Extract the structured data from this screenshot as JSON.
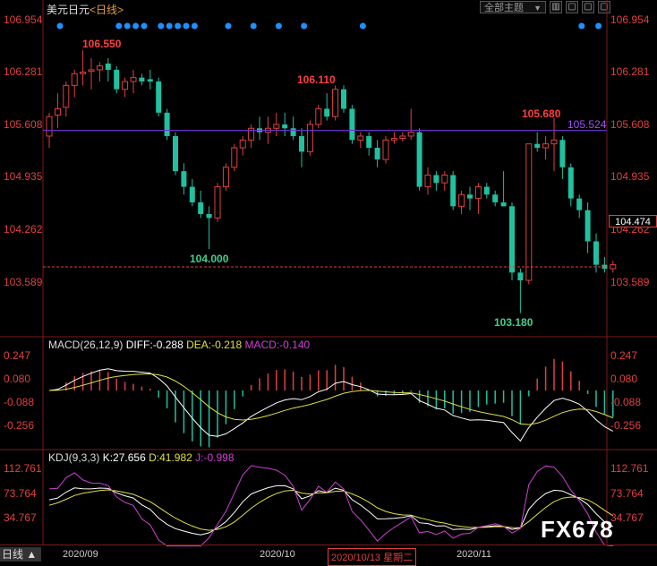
{
  "header": {
    "symbol": "美元日元",
    "period": "<日线>",
    "theme_button": "全部主题",
    "theme_arrow": "▼",
    "window_buttons": [
      "▥",
      "▢",
      "▢",
      "▢"
    ]
  },
  "price_axis": [
    "106.954",
    "106.281",
    "105.608",
    "104.935",
    "104.262",
    "103.589"
  ],
  "current_price": "104.474",
  "annotations": {
    "high1": "106.550",
    "high2": "106.110",
    "high3": "105.680",
    "low1": "104.000",
    "low2": "103.180",
    "hline": "105.524"
  },
  "macd": {
    "label": "MACD(26,12,9)",
    "diff": "DIFF:-0.288",
    "dea": "DEA:-0.218",
    "macd": "MACD:-0.140",
    "axis": [
      "0.247",
      "0.080",
      "-0.088",
      "-0.256"
    ]
  },
  "kdj": {
    "label": "KDJ(9,3,3)",
    "k": "K:27.656",
    "d": "D:41.982",
    "j": "J:-0.998",
    "axis": [
      "112.761",
      "73.764",
      "34.767"
    ]
  },
  "dates": {
    "d1": "2020/09",
    "d2": "2020/10",
    "selected": "2020/10/13 星期二",
    "d3": "2020/11"
  },
  "bottom_left": "日线 ▲",
  "watermark": "FX678",
  "colors": {
    "up": "#e04040",
    "down": "#20c0a0",
    "hline": "#7030d0",
    "diff": "#ffffff",
    "dea": "#e0e040",
    "macd": "#d040d0"
  },
  "chart_data": {
    "type": "candlestick",
    "ohlc": [
      [
        105.45,
        105.75,
        105.3,
        105.7
      ],
      [
        105.72,
        106.0,
        105.55,
        105.8
      ],
      [
        105.82,
        106.15,
        105.7,
        106.1
      ],
      [
        106.1,
        106.3,
        105.95,
        106.25
      ],
      [
        106.25,
        106.55,
        106.1,
        106.27
      ],
      [
        106.28,
        106.45,
        106.05,
        106.3
      ],
      [
        106.3,
        106.4,
        106.15,
        106.35
      ],
      [
        106.38,
        106.45,
        106.15,
        106.3
      ],
      [
        106.3,
        106.35,
        106.0,
        106.05
      ],
      [
        106.05,
        106.2,
        105.95,
        106.15
      ],
      [
        106.15,
        106.3,
        106.0,
        106.2
      ],
      [
        106.2,
        106.25,
        106.1,
        106.15
      ],
      [
        106.18,
        106.3,
        106.05,
        106.15
      ],
      [
        106.15,
        106.2,
        105.7,
        105.75
      ],
      [
        105.75,
        105.8,
        105.4,
        105.45
      ],
      [
        105.45,
        105.5,
        104.95,
        105.0
      ],
      [
        105.0,
        105.1,
        104.7,
        104.8
      ],
      [
        104.8,
        104.9,
        104.55,
        104.6
      ],
      [
        104.6,
        104.75,
        104.4,
        104.45
      ],
      [
        104.45,
        104.55,
        104.0,
        104.4
      ],
      [
        104.4,
        104.85,
        104.35,
        104.8
      ],
      [
        104.8,
        105.1,
        104.75,
        105.05
      ],
      [
        105.05,
        105.35,
        105.0,
        105.3
      ],
      [
        105.3,
        105.45,
        105.2,
        105.4
      ],
      [
        105.4,
        105.6,
        105.3,
        105.55
      ],
      [
        105.55,
        105.7,
        105.4,
        105.5
      ],
      [
        105.5,
        105.7,
        105.35,
        105.55
      ],
      [
        105.55,
        105.75,
        105.45,
        105.6
      ],
      [
        105.6,
        105.75,
        105.45,
        105.55
      ],
      [
        105.55,
        105.7,
        105.4,
        105.45
      ],
      [
        105.45,
        105.55,
        105.05,
        105.25
      ],
      [
        105.25,
        105.65,
        105.2,
        105.6
      ],
      [
        105.6,
        105.85,
        105.55,
        105.8
      ],
      [
        105.8,
        106.0,
        105.65,
        105.7
      ],
      [
        105.7,
        106.1,
        105.65,
        106.05
      ],
      [
        106.05,
        106.1,
        105.75,
        105.8
      ],
      [
        105.8,
        105.85,
        105.35,
        105.4
      ],
      [
        105.4,
        105.5,
        105.3,
        105.45
      ],
      [
        105.45,
        105.5,
        105.2,
        105.3
      ],
      [
        105.3,
        105.4,
        105.05,
        105.15
      ],
      [
        105.15,
        105.45,
        105.1,
        105.4
      ],
      [
        105.4,
        105.5,
        105.35,
        105.42
      ],
      [
        105.42,
        105.5,
        105.38,
        105.45
      ],
      [
        105.45,
        105.8,
        105.4,
        105.5
      ],
      [
        105.5,
        105.55,
        104.75,
        104.8
      ],
      [
        104.8,
        105.05,
        104.7,
        104.95
      ],
      [
        104.95,
        105.0,
        104.75,
        104.85
      ],
      [
        104.85,
        105.0,
        104.75,
        104.95
      ],
      [
        104.95,
        105.0,
        104.5,
        104.55
      ],
      [
        104.55,
        104.75,
        104.45,
        104.7
      ],
      [
        104.7,
        104.8,
        104.5,
        104.65
      ],
      [
        104.65,
        104.85,
        104.45,
        104.8
      ],
      [
        104.8,
        104.85,
        104.65,
        104.7
      ],
      [
        104.7,
        104.75,
        104.55,
        104.6
      ],
      [
        104.6,
        105.0,
        104.55,
        104.55
      ],
      [
        104.55,
        104.6,
        103.6,
        103.7
      ],
      [
        103.7,
        103.75,
        103.18,
        103.6
      ],
      [
        103.6,
        105.2,
        103.55,
        105.35
      ],
      [
        105.35,
        105.5,
        105.25,
        105.3
      ],
      [
        105.3,
        105.45,
        105.15,
        105.35
      ],
      [
        105.35,
        105.68,
        105.0,
        105.4
      ],
      [
        105.4,
        105.45,
        104.9,
        105.05
      ],
      [
        105.05,
        105.1,
        104.55,
        104.65
      ],
      [
        104.65,
        104.7,
        104.4,
        104.5
      ],
      [
        104.5,
        104.6,
        103.95,
        104.1
      ],
      [
        104.1,
        104.2,
        103.7,
        103.8
      ],
      [
        103.8,
        103.9,
        103.7,
        103.75
      ],
      [
        103.75,
        103.85,
        103.7,
        103.8
      ]
    ],
    "ylim": [
      103.1,
      107.1
    ],
    "hline": 105.524,
    "current": 104.474
  }
}
